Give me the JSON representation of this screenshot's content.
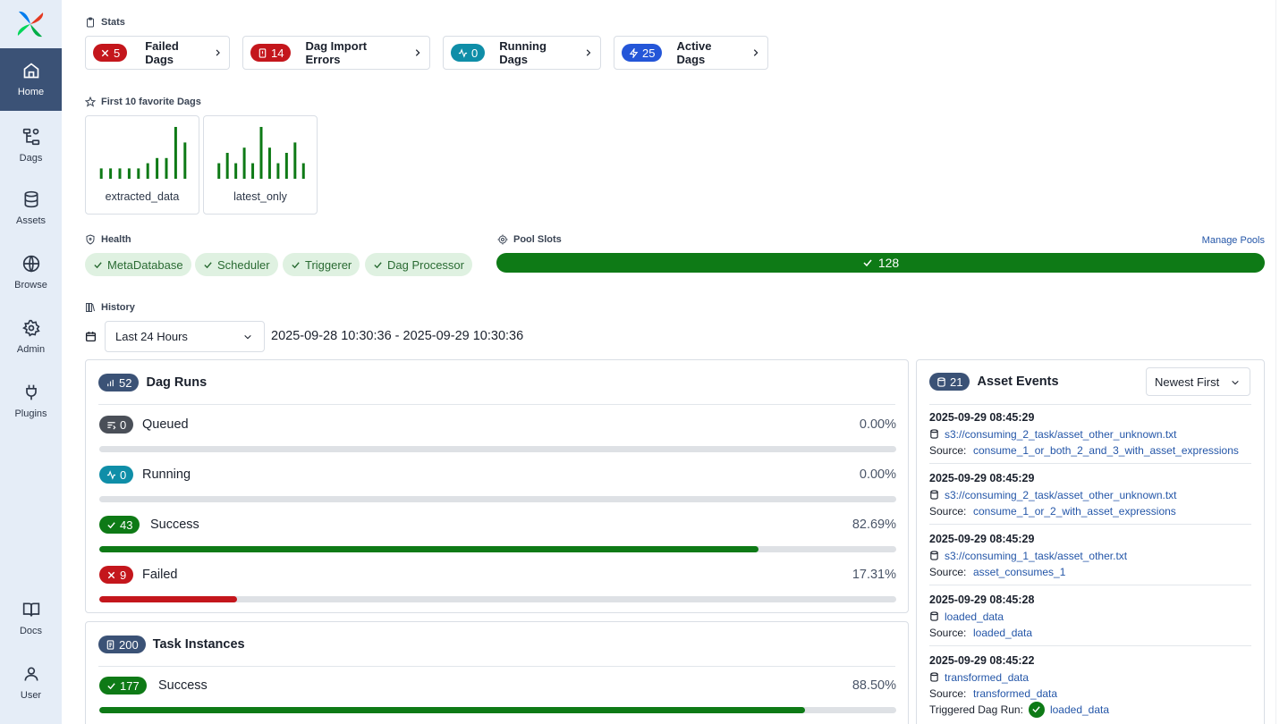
{
  "nav": {
    "items": [
      {
        "label": "Home",
        "icon": "home-icon"
      },
      {
        "label": "Dags",
        "icon": "dags-icon"
      },
      {
        "label": "Assets",
        "icon": "database-icon"
      },
      {
        "label": "Browse",
        "icon": "globe-icon"
      },
      {
        "label": "Admin",
        "icon": "gear-icon"
      },
      {
        "label": "Plugins",
        "icon": "plug-icon"
      }
    ],
    "bottom": [
      {
        "label": "Docs",
        "icon": "book-icon"
      },
      {
        "label": "User",
        "icon": "user-icon"
      }
    ]
  },
  "stats": {
    "heading": "Stats",
    "cards": [
      {
        "count": "5",
        "label": "Failed Dags",
        "color": "#c4161c"
      },
      {
        "count": "14",
        "label": "Dag Import Errors",
        "color": "#c4161c"
      },
      {
        "count": "0",
        "label": "Running Dags",
        "color": "#0f8ea8"
      },
      {
        "count": "25",
        "label": "Active Dags",
        "color": "#2456d8"
      }
    ]
  },
  "favorites": {
    "heading": "First 10 favorite Dags",
    "dags": [
      {
        "name": "extracted_data",
        "runs": [
          2,
          2,
          2,
          2,
          2,
          3,
          4,
          4,
          10,
          7
        ]
      },
      {
        "name": "latest_only",
        "runs": [
          3,
          5,
          3,
          6,
          3,
          10,
          6,
          3,
          5,
          7,
          3
        ]
      }
    ]
  },
  "health": {
    "heading": "Health",
    "items": [
      "MetaDatabase",
      "Scheduler",
      "Triggerer",
      "Dag Processor"
    ]
  },
  "pool": {
    "heading": "Pool Slots",
    "manage_label": "Manage Pools",
    "value": "128",
    "fill_fraction": 1.0
  },
  "history": {
    "heading": "History",
    "range_select": "Last 24 Hours",
    "date_range": "2025-09-28 10:30:36 - 2025-09-29 10:30:36"
  },
  "dag_runs": {
    "title": "Dag Runs",
    "count": "52",
    "states": [
      {
        "count": "0",
        "name": "Queued",
        "pct": "0.00%",
        "fraction": 0.0,
        "color": "#4a4f58"
      },
      {
        "count": "0",
        "name": "Running",
        "pct": "0.00%",
        "fraction": 0.0,
        "color": "#0f8ea8"
      },
      {
        "count": "43",
        "name": "Success",
        "pct": "82.69%",
        "fraction": 0.8269,
        "color": "#0e7a16"
      },
      {
        "count": "9",
        "name": "Failed",
        "pct": "17.31%",
        "fraction": 0.1731,
        "color": "#c4161c"
      }
    ]
  },
  "task_instances": {
    "title": "Task Instances",
    "count": "200",
    "states": [
      {
        "count": "177",
        "name": "Success",
        "pct": "88.50%",
        "fraction": 0.885,
        "color": "#0e7a16"
      }
    ]
  },
  "asset_events": {
    "title": "Asset Events",
    "count": "21",
    "sort_label": "Newest First",
    "source_label": "Source:",
    "triggered_label": "Triggered Dag Run:",
    "events": [
      {
        "timestamp": "2025-09-29 08:45:29",
        "asset": "s3://consuming_2_task/asset_other_unknown.txt",
        "source": "consume_1_or_both_2_and_3_with_asset_expressions"
      },
      {
        "timestamp": "2025-09-29 08:45:29",
        "asset": "s3://consuming_2_task/asset_other_unknown.txt",
        "source": "consume_1_or_2_with_asset_expressions"
      },
      {
        "timestamp": "2025-09-29 08:45:29",
        "asset": "s3://consuming_1_task/asset_other.txt",
        "source": "asset_consumes_1"
      },
      {
        "timestamp": "2025-09-29 08:45:28",
        "asset": "loaded_data",
        "source": "loaded_data"
      },
      {
        "timestamp": "2025-09-29 08:45:22",
        "asset": "transformed_data",
        "source": "transformed_data",
        "triggered": "loaded_data"
      }
    ]
  }
}
